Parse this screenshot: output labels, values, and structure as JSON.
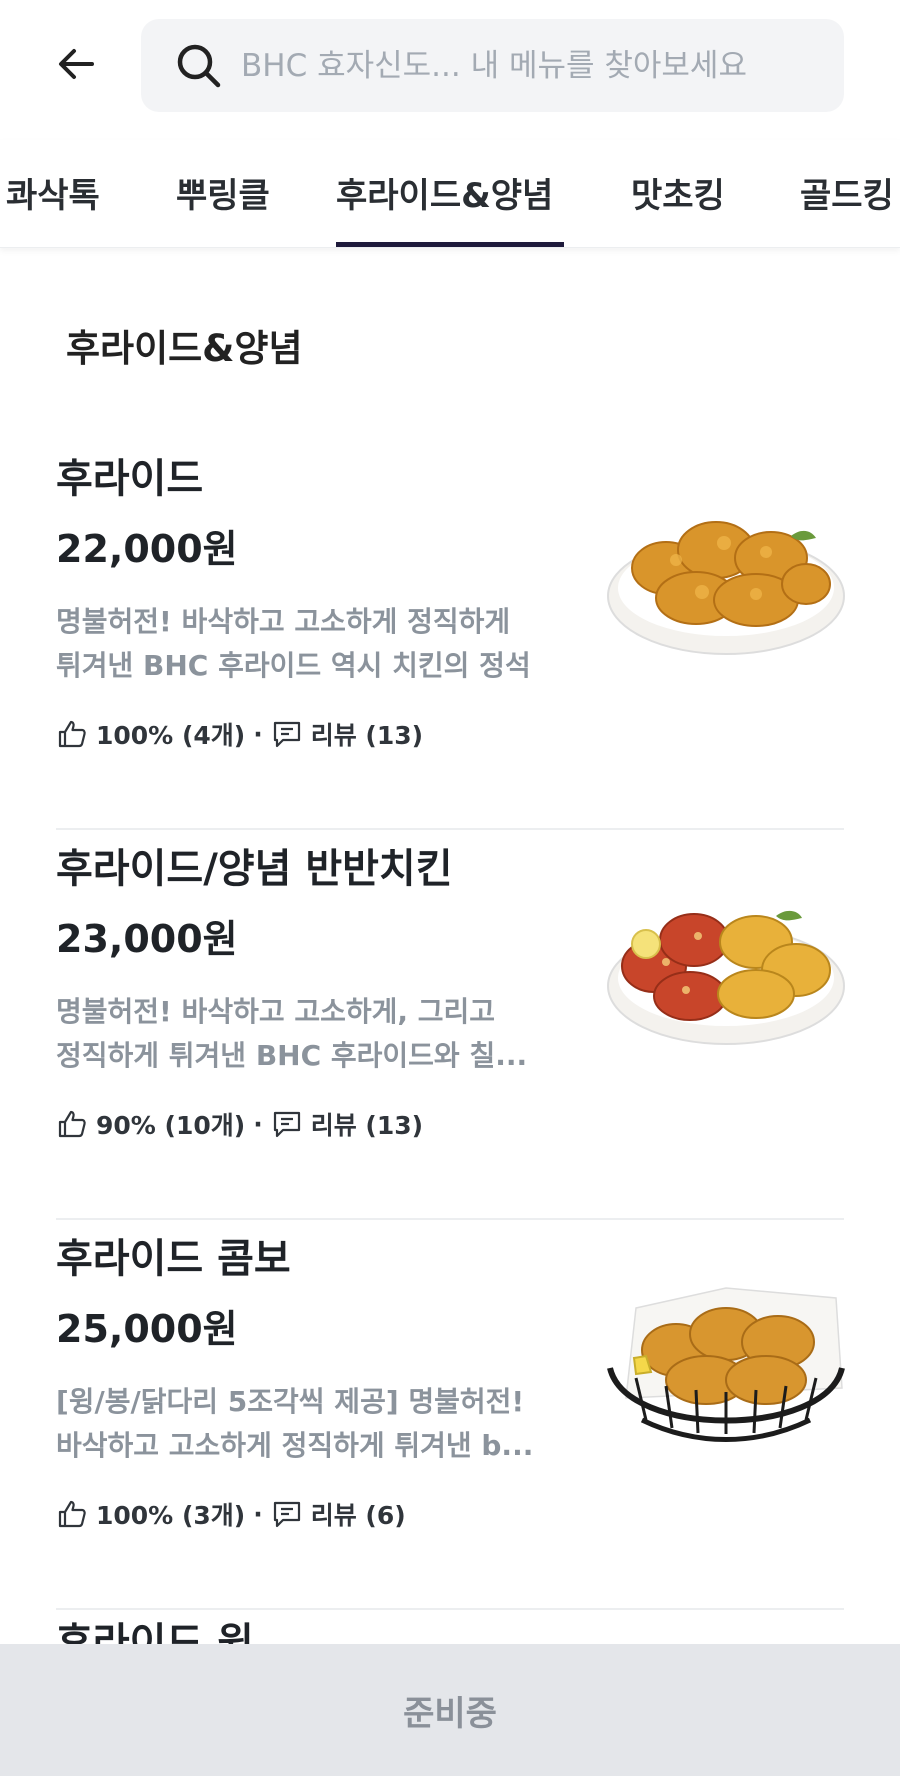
{
  "header": {
    "search_placeholder": "BHC 효자신도... 내 메뉴를 찾아보세요"
  },
  "tabs": [
    {
      "label": "콰삭톡",
      "active": false
    },
    {
      "label": "뿌링클",
      "active": false
    },
    {
      "label": "후라이드&양념",
      "active": true
    },
    {
      "label": "맛초킹",
      "active": false
    },
    {
      "label": "골드킹",
      "active": false
    }
  ],
  "section": {
    "title": "후라이드&양념"
  },
  "items": [
    {
      "name": "후라이드",
      "price": "22,000원",
      "desc_line1": "명불허전! 바삭하고 고소하게 정직하게",
      "desc_line2": "튀겨낸 BHC 후라이드 역시 치킨의 정석",
      "rating": "100% (4개)",
      "reviews": "리뷰 (13)"
    },
    {
      "name": "후라이드/양념 반반치킨",
      "price": "23,000원",
      "desc_line1": "명불허전! 바삭하고 고소하게, 그리고",
      "desc_line2": "정직하게 튀겨낸 BHC 후라이드와 칠...",
      "rating": "90% (10개)",
      "reviews": "리뷰 (13)"
    },
    {
      "name": "후라이드 콤보",
      "price": "25,000원",
      "desc_line1": "[윙/봉/닭다리 5조각씩 제공] 명불허전!",
      "desc_line2": "바삭하고 고소하게 정직하게 튀겨낸 b...",
      "rating": "100% (3개)",
      "reviews": "리뷰 (6)"
    }
  ],
  "partial_item": {
    "name": "후라이드 윙"
  },
  "bottom_bar": {
    "label": "준비중"
  },
  "colors": {
    "tab_indicator": "#1e1a3b",
    "desc_text": "#8b939c",
    "bottom_bar_bg": "#e4e6ea"
  }
}
